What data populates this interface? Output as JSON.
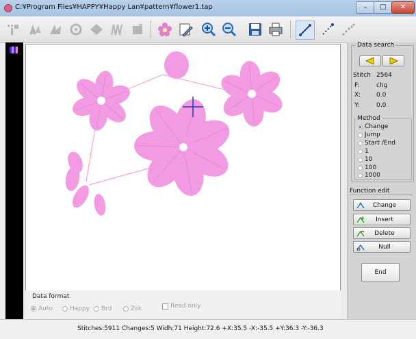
{
  "window": {
    "title": "C:¥Program Files¥HAPPY¥Happy Lan¥pattern¥flower1.tap",
    "controls": {
      "minimize": "–",
      "maximize": "□",
      "close": "✕"
    }
  },
  "toolbar": {
    "buttons": [
      {
        "name": "stitch-tool-1-icon",
        "enabled": false
      },
      {
        "name": "stitch-tool-2-icon",
        "enabled": false
      },
      {
        "name": "stitch-tool-3-icon",
        "enabled": false
      },
      {
        "name": "stitch-tool-4-icon",
        "enabled": false
      },
      {
        "name": "stitch-tool-5-icon",
        "enabled": false
      },
      {
        "name": "stitch-tool-6-icon",
        "enabled": false
      },
      {
        "name": "stitch-tool-7-icon",
        "enabled": false
      },
      {
        "name": "flower-icon",
        "enabled": true
      },
      {
        "name": "edit-document-icon",
        "enabled": true
      },
      {
        "name": "zoom-in-icon",
        "enabled": true
      },
      {
        "name": "zoom-out-icon",
        "enabled": true
      },
      {
        "name": "save-icon",
        "enabled": true
      },
      {
        "name": "print-icon",
        "enabled": true
      },
      {
        "name": "solid-line-view-icon",
        "enabled": true
      },
      {
        "name": "dotted-line-view-icon",
        "enabled": true
      },
      {
        "name": "point-view-icon",
        "enabled": true
      }
    ]
  },
  "data_search": {
    "title": "Data search",
    "stitch_label": "Stitch",
    "stitch_value": "2564",
    "f_label": "F:",
    "f_value": "chg",
    "x_label": "X:",
    "x_value": "0.0",
    "y_label": "Y:",
    "y_value": "0.0",
    "method": {
      "title": "Method",
      "options": [
        "Change",
        "Jump",
        "Start /End",
        "1",
        "10",
        "100",
        "1000"
      ],
      "selected": "Change"
    }
  },
  "function_edit": {
    "title": "Function edit",
    "buttons": [
      "Change",
      "Insert",
      "Delete",
      "Null"
    ]
  },
  "end_label": "End",
  "data_format": {
    "title": "Data format",
    "options": [
      "Auto",
      "Happy",
      "Brd",
      "Zsk"
    ],
    "selected": "Auto",
    "read_only_label": "Read only"
  },
  "status": {
    "text": "Stitches:5911  Changes:5  Widh:71  Height:72.6  +X:35.5  -X:-35.5  +Y:36.3  -Y:-36.3"
  },
  "colors": {
    "stitch_color": "#f29be3",
    "jump_line_color": "#f4a2e6",
    "cursor_color": "#1f3fbf",
    "left_strip": "#000000"
  }
}
